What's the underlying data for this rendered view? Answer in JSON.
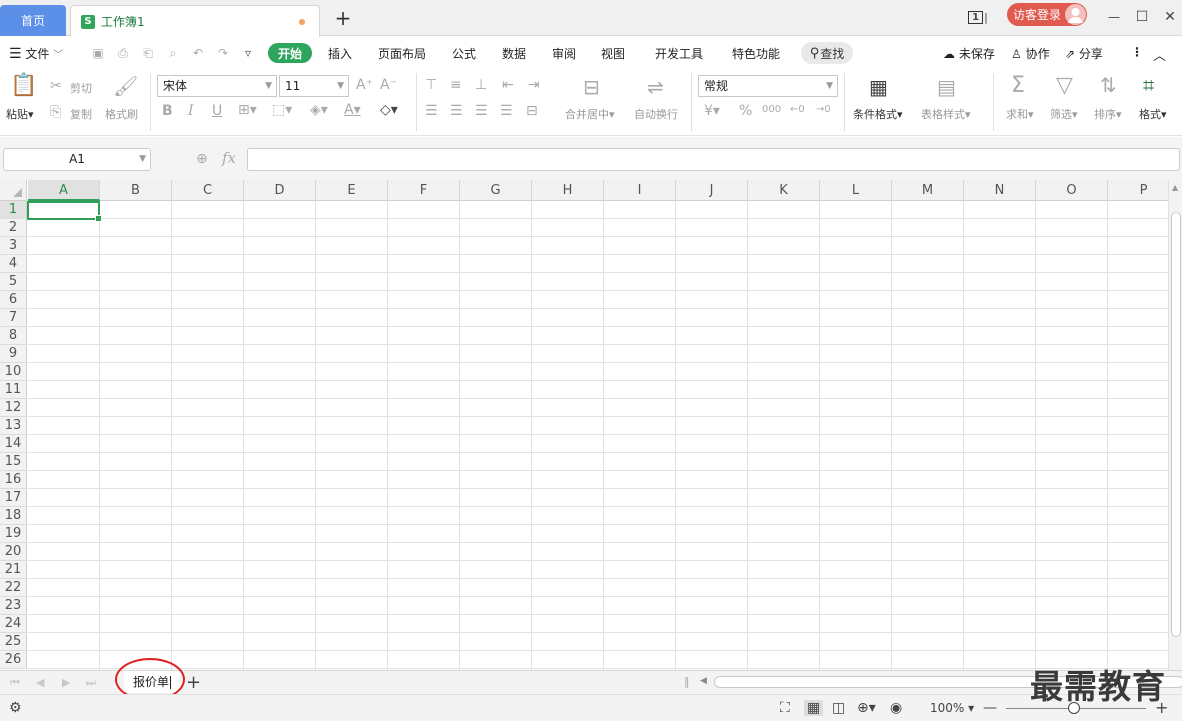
{
  "titlebar": {
    "home_tab": "首页",
    "doc_tab": "工作簿1",
    "doc_logo": "S",
    "new_tab": "+",
    "page_indicator": "1",
    "login": "访客登录",
    "minimize": "—",
    "maximize": "☐",
    "close": "✕"
  },
  "menubar": {
    "file": "文件",
    "tabs": [
      "开始",
      "插入",
      "页面布局",
      "公式",
      "数据",
      "审阅",
      "视图",
      "开发工具",
      "特色功能"
    ],
    "find": "查找",
    "unsaved": "未保存",
    "collaborate": "协作",
    "share": "分享"
  },
  "ribbon": {
    "paste": "粘贴",
    "cut": "剪切",
    "copy": "复制",
    "format_painter": "格式刷",
    "font_name": "宋体",
    "font_size": "11",
    "merge_center": "合并居中",
    "wrap_text": "自动换行",
    "number_format": "常规",
    "conditional_format": "条件格式",
    "table_style": "表格样式",
    "sum": "求和",
    "filter": "筛选",
    "sort": "排序",
    "format": "格式"
  },
  "formula_bar": {
    "name_box": "A1",
    "fx": "fx",
    "formula": ""
  },
  "grid": {
    "columns": [
      "A",
      "B",
      "C",
      "D",
      "E",
      "F",
      "G",
      "H",
      "I",
      "J",
      "K",
      "L",
      "M",
      "N",
      "O",
      "P"
    ],
    "rows": [
      "1",
      "2",
      "3",
      "4",
      "5",
      "6",
      "7",
      "8",
      "9",
      "10",
      "11",
      "12",
      "13",
      "14",
      "15",
      "16",
      "17",
      "18",
      "19",
      "20",
      "21",
      "22",
      "23",
      "24",
      "25",
      "26"
    ],
    "active_cell": "A1"
  },
  "sheets": {
    "tabs": [
      "报价单"
    ],
    "add": "+"
  },
  "statusbar": {
    "zoom": "100%",
    "zoom_out": "—",
    "zoom_in": "+"
  },
  "watermark": "最需教育",
  "colors": {
    "accent": "#2ea55d",
    "home_tab": "#5b8fe8",
    "login": "#e05a50",
    "annotation": "#e02020"
  }
}
